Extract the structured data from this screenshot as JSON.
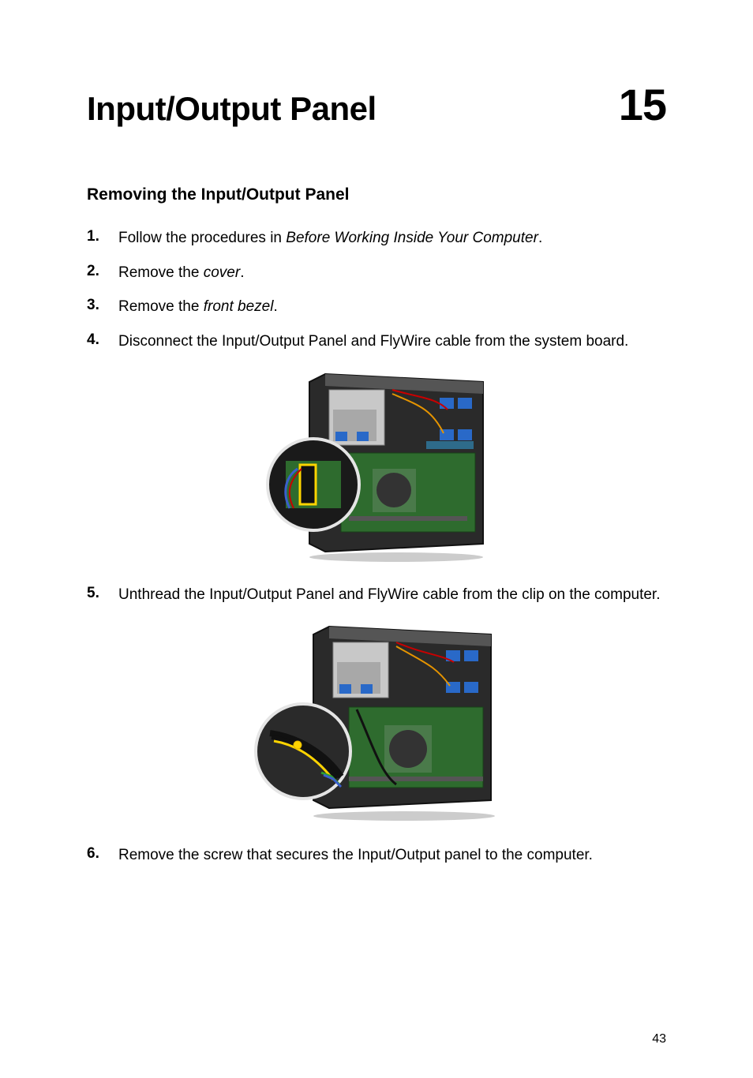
{
  "chapter": {
    "title": "Input/Output Panel",
    "number": "15"
  },
  "section": {
    "heading": "Removing the Input/Output Panel"
  },
  "steps": [
    {
      "marker": "1.",
      "prefix": "Follow the procedures in ",
      "em": "Before Working Inside Your Computer",
      "suffix": "."
    },
    {
      "marker": "2.",
      "prefix": "Remove the ",
      "em": "cover",
      "suffix": "."
    },
    {
      "marker": "3.",
      "prefix": "Remove the ",
      "em": "front bezel",
      "suffix": "."
    },
    {
      "marker": "4.",
      "prefix": "Disconnect the Input/Output Panel and FlyWire cable from the system board.",
      "em": "",
      "suffix": ""
    },
    {
      "marker": "5.",
      "prefix": "Unthread the Input/Output Panel and FlyWire cable from the clip on the computer.",
      "em": "",
      "suffix": ""
    },
    {
      "marker": "6.",
      "prefix": "Remove the screw that secures the Input/Output panel to the computer.",
      "em": "",
      "suffix": ""
    }
  ],
  "pageNumber": "43"
}
